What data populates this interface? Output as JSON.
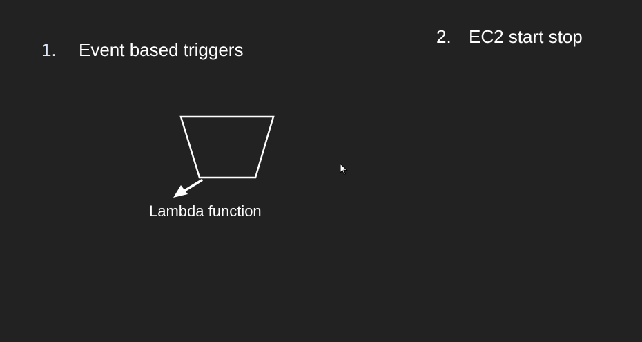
{
  "slide": {
    "items": [
      {
        "number": "1.",
        "text": "Event based triggers"
      },
      {
        "number": "2.",
        "text": "EC2 start stop"
      }
    ],
    "diagram": {
      "shape_label": "Lambda function",
      "icons": {
        "shape": "trapezoid-outline",
        "arrow": "arrow-down-left-icon",
        "pointer": "mouse-cursor-icon"
      }
    },
    "colors": {
      "background": "#222222",
      "text": "#ffffff",
      "number_accent": "#dbe6f7"
    }
  }
}
